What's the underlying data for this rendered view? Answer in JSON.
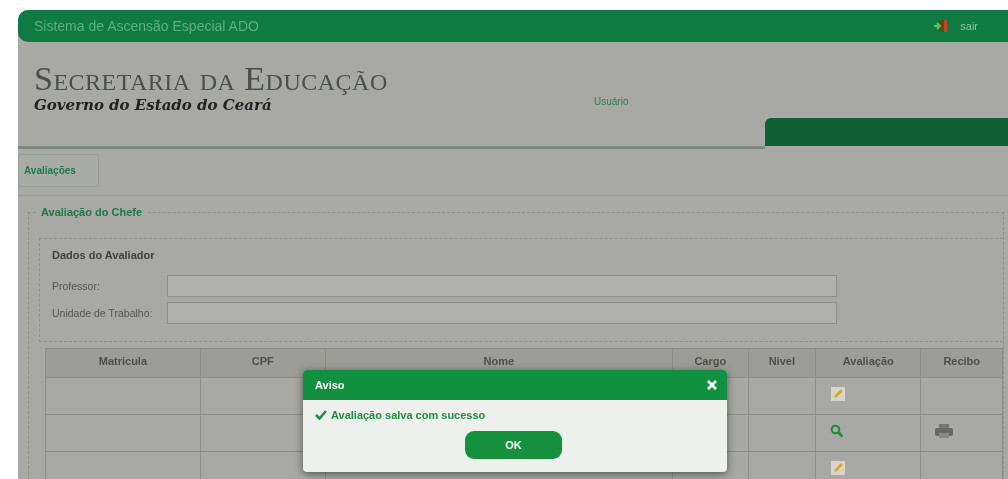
{
  "top_bar": {
    "title": "Sistema de Ascensão Especial ADO",
    "logout": "sair"
  },
  "header": {
    "title": "Secretaria da Educação",
    "subtitle": "Governo do Estado do Ceará",
    "user_label": "Usuário"
  },
  "menu": [
    {
      "label": "Avaliações"
    }
  ],
  "section": {
    "legend": "Avaliação do Chefe",
    "evaluator": {
      "legend": "Dados do Avaliador",
      "fields": [
        {
          "label": "Professor:"
        },
        {
          "label": "Unidade de Trabalho:"
        }
      ]
    }
  },
  "table": {
    "columns": [
      "Matricula",
      "CPF",
      "Nome",
      "Cargo",
      "Nivel",
      "Avaliação",
      "Recibo"
    ],
    "rows": [
      {
        "kind": "edit",
        "receipt": false
      },
      {
        "kind": "view",
        "receipt": true
      },
      {
        "kind": "edit",
        "receipt": false
      }
    ]
  },
  "dialog": {
    "title": "Aviso",
    "message": "Avaliação salva com sucesso",
    "button": "OK"
  }
}
